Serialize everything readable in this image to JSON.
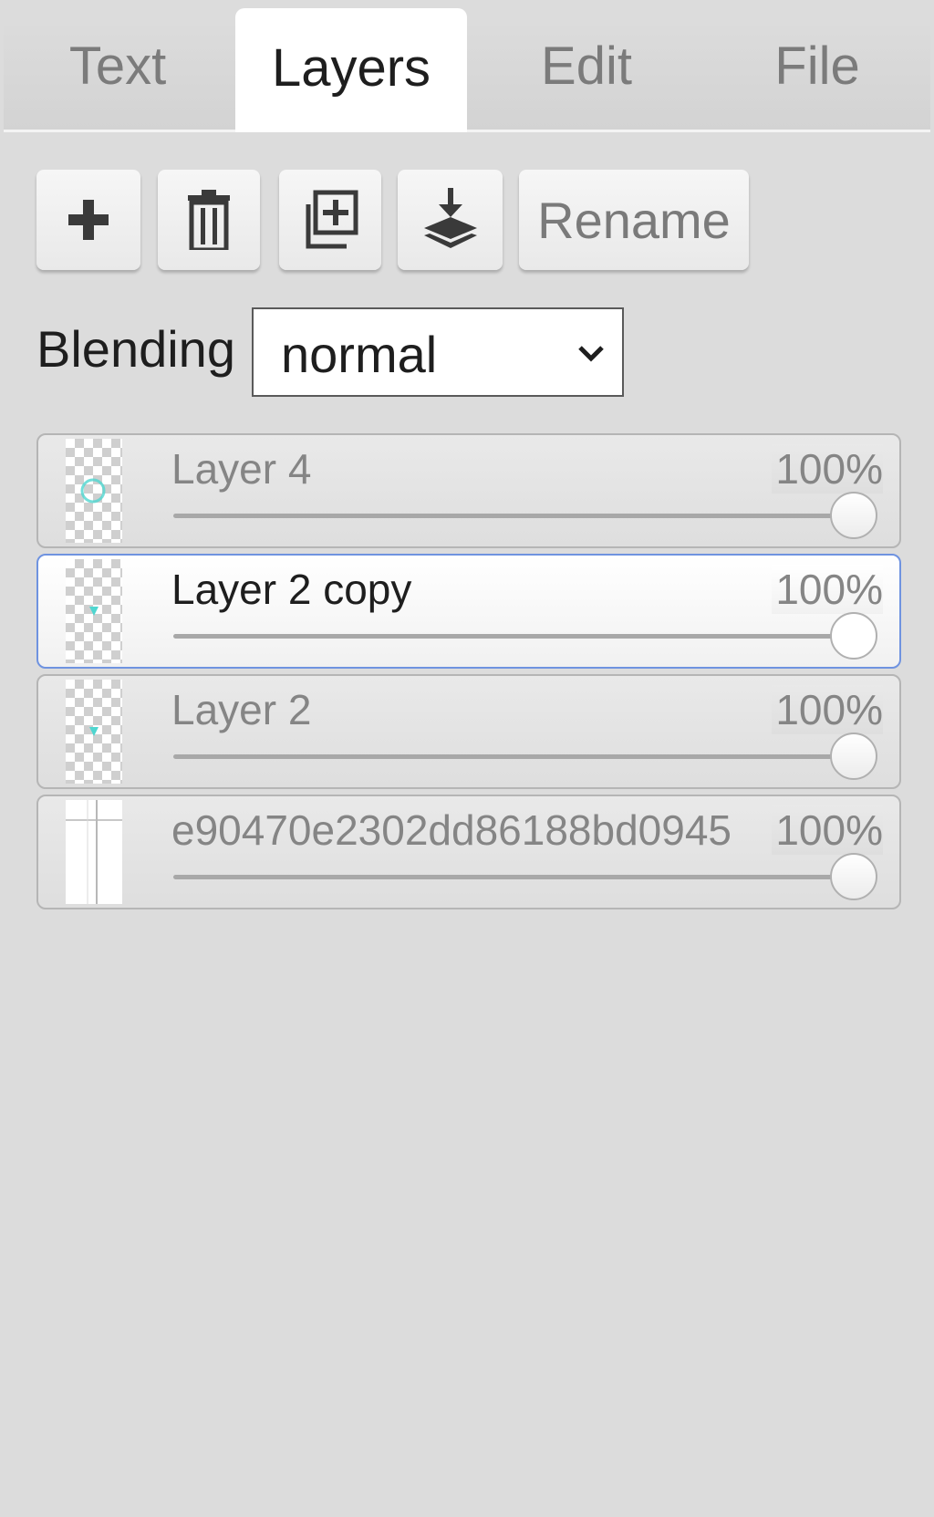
{
  "tabs": [
    {
      "label": "Text",
      "active": false
    },
    {
      "label": "Layers",
      "active": true
    },
    {
      "label": "Edit",
      "active": false
    },
    {
      "label": "File",
      "active": false
    }
  ],
  "toolbar": {
    "add_icon": "plus-icon",
    "delete_icon": "trash-icon",
    "duplicate_icon": "duplicate-icon",
    "merge_icon": "merge-down-icon",
    "rename_label": "Rename"
  },
  "blending": {
    "label": "Blending",
    "value": "normal"
  },
  "layers": [
    {
      "name": "Layer 4",
      "opacity_label": "100%",
      "opacity": 1.0,
      "active": false
    },
    {
      "name": "Layer 2 copy",
      "opacity_label": "100%",
      "opacity": 1.0,
      "active": true
    },
    {
      "name": "Layer 2",
      "opacity_label": "100%",
      "opacity": 1.0,
      "active": false
    },
    {
      "name": "e90470e2302dd86188bd0945",
      "opacity_label": "100%",
      "opacity": 1.0,
      "active": false
    }
  ],
  "colors": {
    "background": "#dcdcdc",
    "active_border": "#6f93e0",
    "thumb_accent": "#4fd6d0"
  }
}
